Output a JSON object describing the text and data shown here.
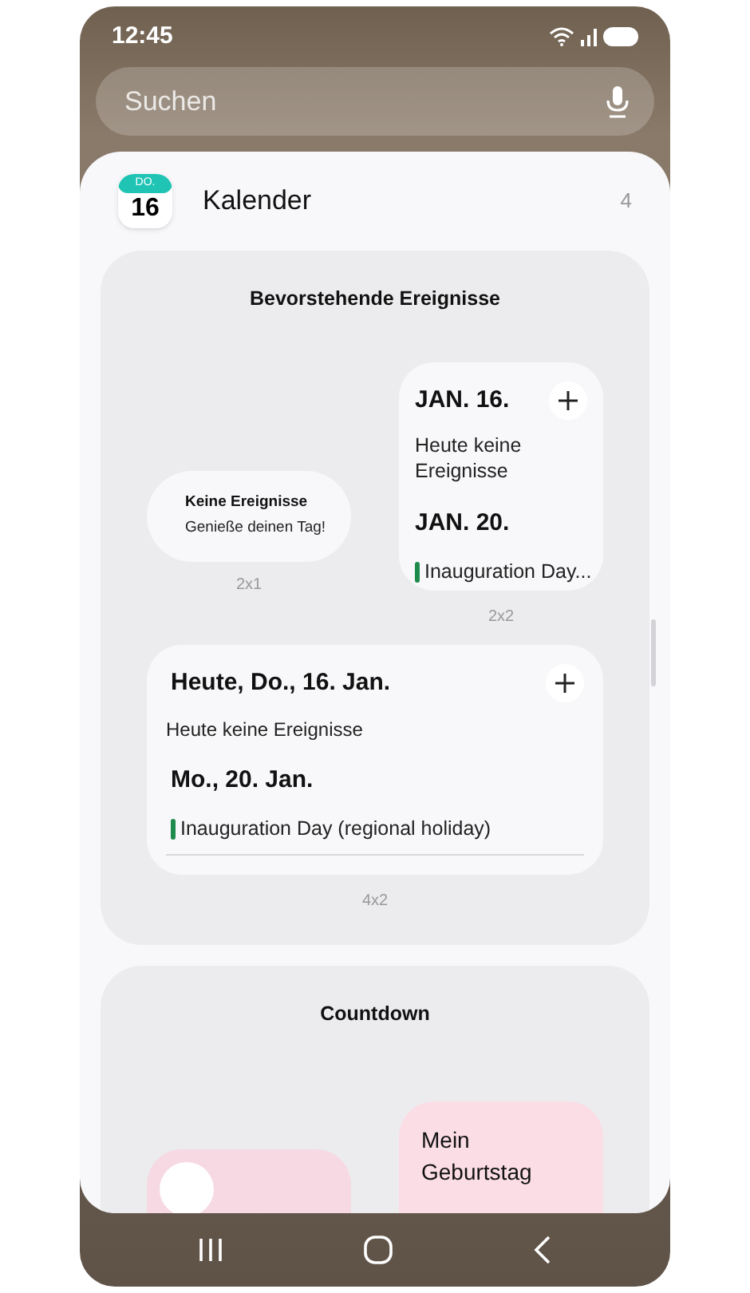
{
  "status_bar": {
    "time": "12:45"
  },
  "search": {
    "placeholder": "Suchen"
  },
  "app": {
    "icon_weekday": "DO.",
    "icon_day": "16",
    "name": "Kalender",
    "count": "4"
  },
  "groups": [
    {
      "title": "Bevorstehende Ereignisse",
      "widgets": [
        {
          "kind": "pill",
          "title": "Keine Ereignisse",
          "subtitle": "Genieße deinen Tag!",
          "size": "2x1"
        },
        {
          "kind": "agenda",
          "size": "2x2",
          "days": [
            {
              "date": "JAN. 16.",
              "note": "Heute keine Ereignisse"
            },
            {
              "date": "JAN. 20.",
              "events": [
                {
                  "title": "Inauguration Day...",
                  "color": "#1e8a4c"
                }
              ]
            }
          ]
        },
        {
          "kind": "agenda",
          "size": "4x2",
          "days": [
            {
              "date": "Heute, Do., 16. Jan.",
              "note": "Heute keine Ereignisse"
            },
            {
              "date": "Mo., 20. Jan.",
              "events": [
                {
                  "title": "Inauguration Day (regional holiday)",
                  "color": "#1e8a4c"
                }
              ]
            }
          ]
        }
      ]
    },
    {
      "title": "Countdown",
      "widgets": [
        {
          "kind": "countdown_small"
        },
        {
          "kind": "countdown",
          "title": "Mein Geburtstag"
        }
      ]
    }
  ]
}
